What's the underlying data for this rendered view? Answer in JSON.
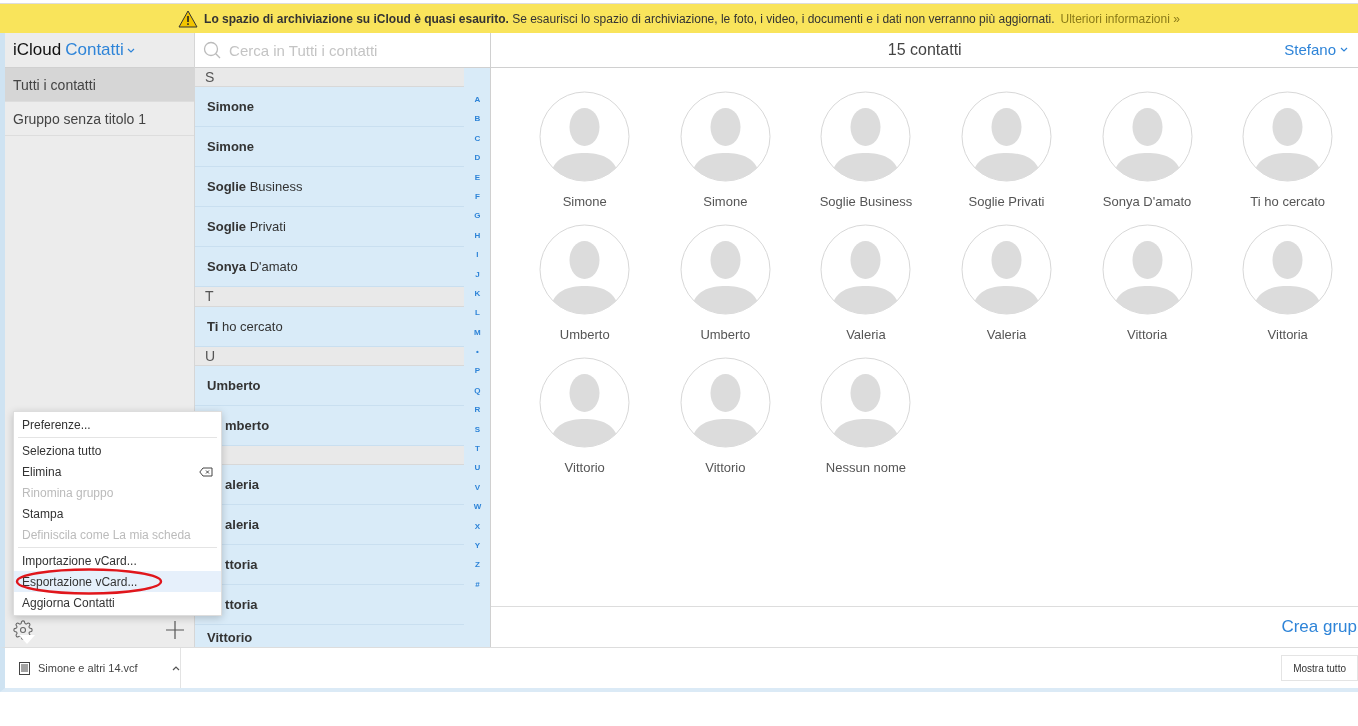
{
  "banner": {
    "bold": "Lo spazio di archiviazione su iCloud è quasi esaurito.",
    "text": "Se esaurisci lo spazio di archiviazione, le foto, i video, i documenti e i dati non verranno più aggiornati.",
    "link": "Ulteriori informazioni »"
  },
  "sidebar": {
    "brand": "iCloud",
    "app": "Contatti",
    "groups": [
      {
        "label": "Tutti i contatti",
        "selected": true
      },
      {
        "label": "Gruppo senza titolo 1",
        "selected": false
      }
    ]
  },
  "menu": {
    "items": [
      {
        "kind": "item",
        "label": "Preferenze...",
        "disabled": false,
        "selected": false
      },
      {
        "kind": "separator"
      },
      {
        "kind": "item",
        "label": "Seleziona tutto",
        "disabled": false,
        "selected": false
      },
      {
        "kind": "item-with-key",
        "label": "Elimina",
        "disabled": false,
        "selected": false
      },
      {
        "kind": "item",
        "label": "Rinomina gruppo",
        "disabled": true,
        "selected": false
      },
      {
        "kind": "item",
        "label": "Stampa",
        "disabled": false,
        "selected": false
      },
      {
        "kind": "item",
        "label": "Definiscila come La mia scheda",
        "disabled": true,
        "selected": false
      },
      {
        "kind": "separator"
      },
      {
        "kind": "item",
        "label": "Importazione vCard...",
        "disabled": false,
        "selected": false
      },
      {
        "kind": "item",
        "label": "Esportazione vCard...",
        "disabled": false,
        "selected": true
      },
      {
        "kind": "item",
        "label": "Aggiorna Contatti",
        "disabled": false,
        "selected": false
      }
    ]
  },
  "search": {
    "placeholder": "Cerca in Tutti i contatti"
  },
  "list": {
    "rows": [
      {
        "kind": "header",
        "letter": "S"
      },
      {
        "kind": "contact",
        "name": "**Simone**"
      },
      {
        "kind": "contact",
        "name": "**Simone**"
      },
      {
        "kind": "contact",
        "name": "**Soglie** Business"
      },
      {
        "kind": "contact",
        "name": "**Soglie** Privati"
      },
      {
        "kind": "contact",
        "name": "**Sonya** D'amato"
      },
      {
        "kind": "header",
        "letter": "T"
      },
      {
        "kind": "contact",
        "name": "**Ti** ho cercato"
      },
      {
        "kind": "header",
        "letter": "U"
      },
      {
        "kind": "contact",
        "name": "**Umberto**"
      },
      {
        "kind": "covered",
        "name": "**mberto**"
      },
      {
        "kind": "header"
      },
      {
        "kind": "covered",
        "name": "**aleria**"
      },
      {
        "kind": "covered",
        "name": "**aleria**"
      },
      {
        "kind": "covered",
        "name": "**ttoria**"
      },
      {
        "kind": "covered",
        "name": "**ttoria**"
      },
      {
        "kind": "contact",
        "name": "**Vittorio**"
      }
    ],
    "index": [
      "A",
      "B",
      "C",
      "D",
      "E",
      "F",
      "G",
      "H",
      "I",
      "J",
      "K",
      "L",
      "M",
      "•",
      "P",
      "Q",
      "R",
      "S",
      "T",
      "U",
      "V",
      "W",
      "X",
      "Y",
      "Z",
      "#"
    ]
  },
  "main": {
    "title": "15 contatti",
    "user": "Stefano",
    "footer_link": "Crea grup",
    "contacts": [
      "Simone",
      "Simone",
      "Soglie Business",
      "Soglie Privati",
      "Sonya D'amato",
      "Ti ho cercato",
      "Umberto",
      "Umberto",
      "Valeria",
      "Valeria",
      "Vittoria",
      "Vittoria",
      "Vittorio",
      "Vittorio",
      "Nessun nome"
    ]
  },
  "downloads": {
    "file": "Simone e altri 14.vcf",
    "show_all": "Mostra tutto"
  }
}
